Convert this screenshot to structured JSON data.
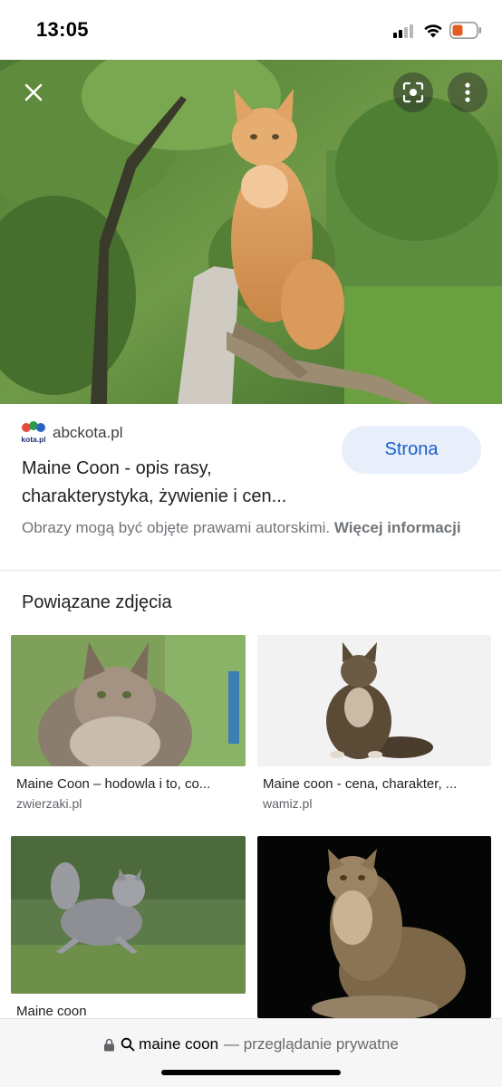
{
  "status_bar": {
    "time": "13:05",
    "battery_color": "#e35d22"
  },
  "hero": {
    "close_icon": "close-icon",
    "lens_icon": "lens-icon",
    "more_icon": "more-vert-icon"
  },
  "source": {
    "favicon_text": "kota.pl",
    "domain": "abckota.pl",
    "visit_button": "Strona",
    "title": "Maine Coon - opis rasy, charakterystyka, żywienie i cen...",
    "copyright_text": "Obrazy mogą być objęte prawami autorskimi.",
    "copyright_link": "Więcej informacji"
  },
  "related": {
    "heading": "Powiązane zdjęcia",
    "items": [
      {
        "title": "Maine Coon – hodowla i to, co...",
        "source": "zwierzaki.pl"
      },
      {
        "title": "Maine coon - cena, charakter, ...",
        "source": "wamiz.pl"
      },
      {
        "title": "Maine coon",
        "source": ""
      },
      {
        "title": "",
        "source": ""
      }
    ]
  },
  "bottom_bar": {
    "query": "maine coon",
    "mode": "— przeglądanie prywatne"
  }
}
